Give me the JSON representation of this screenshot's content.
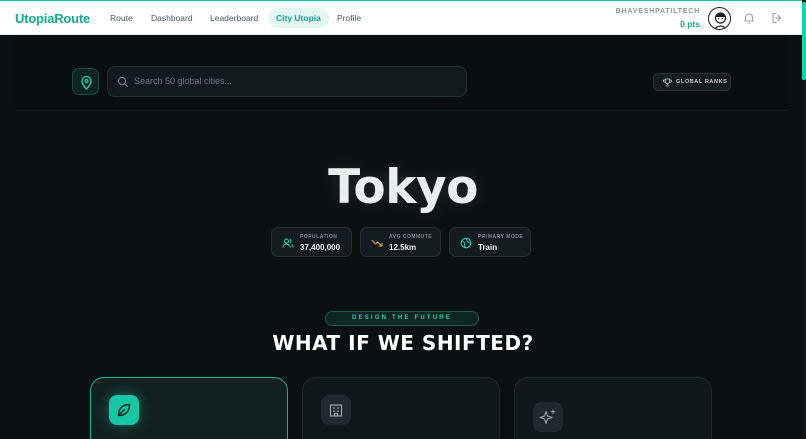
{
  "app": {
    "logo": "UtopiaRoute"
  },
  "nav": {
    "links": [
      {
        "label": "Route"
      },
      {
        "label": "Dashboard"
      },
      {
        "label": "Leaderboard"
      },
      {
        "label": "City Utopia",
        "active": true
      },
      {
        "label": "Profile"
      }
    ]
  },
  "user": {
    "name": "BHAVESHPATILTECH",
    "points": "0 pts"
  },
  "icons": {
    "notifications": "bell-icon",
    "logout": "logout-icon",
    "location": "map-pin-icon",
    "search": "search-icon",
    "trophy": "trophy-icon"
  },
  "search": {
    "placeholder": "Search 50 global cities..."
  },
  "ranks": {
    "label": "GLOBAL RANKS"
  },
  "city": {
    "name": "Tokyo"
  },
  "stats": [
    {
      "label": "POPULATION",
      "value": "37,400,000",
      "icon": "users-icon"
    },
    {
      "label": "AVG COMMUTE",
      "value": "12.5km",
      "icon": "trend-down-icon"
    },
    {
      "label": "PRIMARY MODE",
      "value": "Train",
      "icon": "globe-icon"
    }
  ],
  "section": {
    "eyebrow": "DESIGN THE FUTURE",
    "title": "WHAT IF WE SHIFTED?"
  },
  "cards": [
    {
      "icon": "leaf-icon",
      "active": true
    },
    {
      "icon": "building-icon",
      "active": false
    },
    {
      "icon": "sparkles-icon",
      "active": false
    }
  ],
  "colors": {
    "accent": "#15c3a5",
    "background": "#0b1013",
    "nav_bg": "#ffffff"
  }
}
